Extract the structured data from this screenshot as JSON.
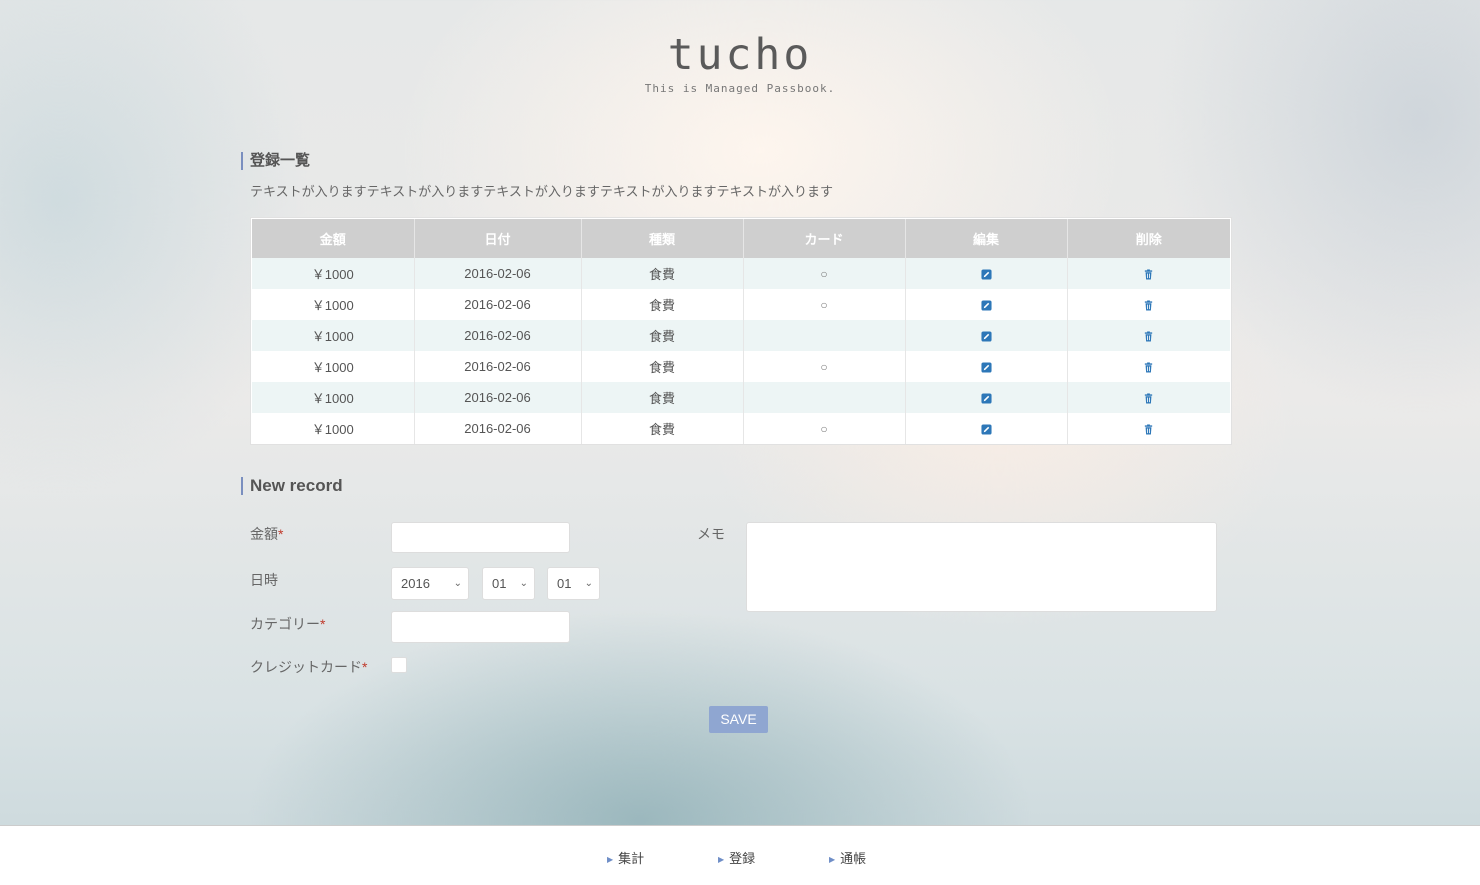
{
  "header": {
    "logo": "tucho",
    "tagline": "This is Managed Passbook."
  },
  "list_section": {
    "title": "登録一覧",
    "description": "テキストが入りますテキストが入りますテキストが入りますテキストが入りますテキストが入ります",
    "columns": [
      "金額",
      "日付",
      "種類",
      "カード",
      "編集",
      "削除"
    ],
    "rows": [
      {
        "amount": "￥1000",
        "date": "2016-02-06",
        "category": "食費",
        "card": "○"
      },
      {
        "amount": "￥1000",
        "date": "2016-02-06",
        "category": "食費",
        "card": "○"
      },
      {
        "amount": "￥1000",
        "date": "2016-02-06",
        "category": "食費",
        "card": ""
      },
      {
        "amount": "￥1000",
        "date": "2016-02-06",
        "category": "食費",
        "card": "○"
      },
      {
        "amount": "￥1000",
        "date": "2016-02-06",
        "category": "食費",
        "card": ""
      },
      {
        "amount": "￥1000",
        "date": "2016-02-06",
        "category": "食費",
        "card": "○"
      }
    ],
    "edit_icon": "edit-icon",
    "delete_icon": "trash-icon"
  },
  "form": {
    "title": "New record",
    "amount_label": "金額",
    "date_label": "日時",
    "category_label": "カテゴリー",
    "credit_label": "クレジットカード",
    "required_mark": "*",
    "memo_label": "メモ",
    "year": "2016",
    "month": "01",
    "day": "01",
    "amount_value": "",
    "category_value": "",
    "memo_value": "",
    "credit_checked": false,
    "save_label": "SAVE"
  },
  "footer": {
    "nav": [
      "集計",
      "登録",
      "通帳"
    ]
  },
  "colors": {
    "accent": "#8fa6d1",
    "icon_blue": "#2d77b8",
    "header_gray": "#cfcfcf",
    "row_tint": "#edf5f5"
  }
}
